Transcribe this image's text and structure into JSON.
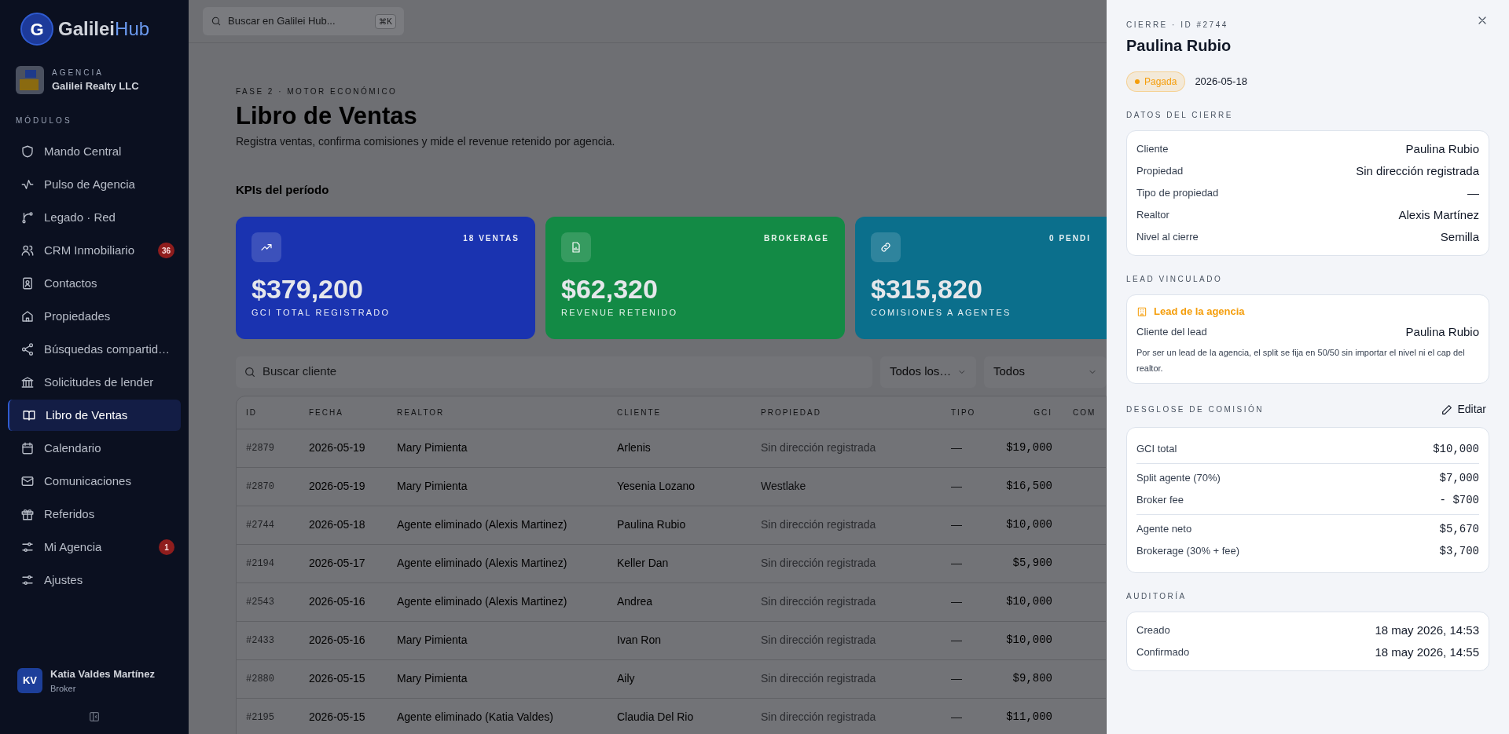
{
  "app": {
    "logo_letter": "G",
    "logo_main": "Galilei",
    "logo_accent": "Hub"
  },
  "agency": {
    "label": "AGENCIA",
    "name": "Galilei Realty LLC"
  },
  "sidebar": {
    "section": "MÓDULOS",
    "items": [
      {
        "label": "Mando Central",
        "selected": false
      },
      {
        "label": "Pulso de Agencia",
        "selected": false
      },
      {
        "label": "Legado · Red",
        "selected": false
      },
      {
        "label": "CRM Inmobiliario",
        "selected": false,
        "badge": "36"
      },
      {
        "label": "Contactos",
        "selected": false
      },
      {
        "label": "Propiedades",
        "selected": false
      },
      {
        "label": "Búsquedas compartid…",
        "selected": false
      },
      {
        "label": "Solicitudes de lender",
        "selected": false
      },
      {
        "label": "Libro de Ventas",
        "selected": true
      },
      {
        "label": "Calendario",
        "selected": false
      },
      {
        "label": "Comunicaciones",
        "selected": false
      },
      {
        "label": "Referidos",
        "selected": false
      },
      {
        "label": "Mi Agencia",
        "selected": false,
        "badge": "1"
      },
      {
        "label": "Ajustes",
        "selected": false
      }
    ]
  },
  "user": {
    "initials": "KV",
    "name": "Katia Valdes Martínez",
    "role": "Broker"
  },
  "topbar": {
    "search_placeholder": "Buscar en Galilei Hub...",
    "shortcut": "⌘K"
  },
  "page": {
    "eyebrow": "FASE 2 · MOTOR ECONÓMICO",
    "title": "Libro de Ventas",
    "subtitle": "Registra ventas, confirma comisiones y mide el revenue retenido por agencia."
  },
  "kpis": {
    "title": "KPIs del período",
    "cards": [
      {
        "tag": "18 VENTAS",
        "value": "$379,200",
        "label": "GCI TOTAL REGISTRADO",
        "color": "#1a33b0"
      },
      {
        "tag": "BROKERAGE",
        "value": "$62,320",
        "label": "REVENUE RETENIDO",
        "color": "#138a45"
      },
      {
        "tag": "0 PENDI",
        "value": "$315,820",
        "label": "COMISIONES A AGENTES",
        "color": "#0b6f8c"
      }
    ]
  },
  "filters": {
    "search_placeholder": "Buscar cliente",
    "selects": [
      "Todos los…",
      "Todos"
    ]
  },
  "table": {
    "columns": [
      "ID",
      "FECHA",
      "REALTOR",
      "CLIENTE",
      "PROPIEDAD",
      "TIPO",
      "GCI",
      "COM"
    ],
    "rows": [
      {
        "id": "#2879",
        "date": "2026-05-19",
        "realtor": "Mary Pimienta",
        "client": "Arlenis",
        "property": "Sin dirección registrada",
        "property_missing": true,
        "type": "—",
        "gci": "$19,000"
      },
      {
        "id": "#2870",
        "date": "2026-05-19",
        "realtor": "Mary Pimienta",
        "client": "Yesenia Lozano",
        "property": "Westlake",
        "property_missing": false,
        "type": "—",
        "gci": "$16,500"
      },
      {
        "id": "#2744",
        "date": "2026-05-18",
        "realtor": "Agente eliminado (Alexis Martinez)",
        "client": "Paulina Rubio",
        "property": "Sin dirección registrada",
        "property_missing": true,
        "type": "—",
        "gci": "$10,000"
      },
      {
        "id": "#2194",
        "date": "2026-05-17",
        "realtor": "Agente eliminado (Alexis Martinez)",
        "client": "Keller Dan",
        "property": "Sin dirección registrada",
        "property_missing": true,
        "type": "—",
        "gci": "$5,900"
      },
      {
        "id": "#2543",
        "date": "2026-05-16",
        "realtor": "Agente eliminado (Alexis Martinez)",
        "client": "Andrea",
        "property": "Sin dirección registrada",
        "property_missing": true,
        "type": "—",
        "gci": "$10,000"
      },
      {
        "id": "#2433",
        "date": "2026-05-16",
        "realtor": "Mary Pimienta",
        "client": "Ivan Ron",
        "property": "Sin dirección registrada",
        "property_missing": true,
        "type": "—",
        "gci": "$10,000"
      },
      {
        "id": "#2880",
        "date": "2026-05-15",
        "realtor": "Mary Pimienta",
        "client": "Aily",
        "property": "Sin dirección registrada",
        "property_missing": true,
        "type": "—",
        "gci": "$9,800"
      },
      {
        "id": "#2195",
        "date": "2026-05-15",
        "realtor": "Agente eliminado (Katia Valdes)",
        "client": "Claudia Del Rio",
        "property": "Sin dirección registrada",
        "property_missing": true,
        "type": "—",
        "gci": "$11,000"
      }
    ]
  },
  "drawer": {
    "eyebrow": "CIERRE · ID #2744",
    "title": "Paulina Rubio",
    "status": {
      "label": "Pagada",
      "color": "#f59e0b"
    },
    "date": "2026-05-18",
    "details": {
      "title": "DATOS DEL CIERRE",
      "rows": [
        {
          "label": "Cliente",
          "value": "Paulina Rubio"
        },
        {
          "label": "Propiedad",
          "value": "Sin dirección registrada"
        },
        {
          "label": "Tipo de propiedad",
          "value": "—"
        },
        {
          "label": "Realtor",
          "value": "Alexis Martínez"
        },
        {
          "label": "Nivel al cierre",
          "value": "Semilla"
        }
      ]
    },
    "lead": {
      "title": "LEAD VINCULADO",
      "heading": "Lead de la agencia",
      "label": "Cliente del lead",
      "value": "Paulina Rubio",
      "note": "Por ser un lead de la agencia, el split se fija en 50/50 sin importar el nivel ni el cap del realtor."
    },
    "commission": {
      "title": "DESGLOSE DE COMISIÓN",
      "edit": "Editar",
      "groups": [
        [
          {
            "label": "GCI total",
            "value": "$10,000"
          }
        ],
        [
          {
            "label": "Split agente (70%)",
            "value": "$7,000"
          },
          {
            "label": "Broker fee",
            "value": "- $700"
          }
        ],
        [
          {
            "label": "Agente neto",
            "value": "$5,670"
          },
          {
            "label": "Brokerage (30% + fee)",
            "value": "$3,700"
          }
        ]
      ]
    },
    "audit": {
      "title": "AUDITORÍA",
      "rows": [
        {
          "label": "Creado",
          "value": "18 may 2026, 14:53"
        },
        {
          "label": "Confirmado",
          "value": "18 may 2026, 14:55"
        }
      ]
    }
  }
}
